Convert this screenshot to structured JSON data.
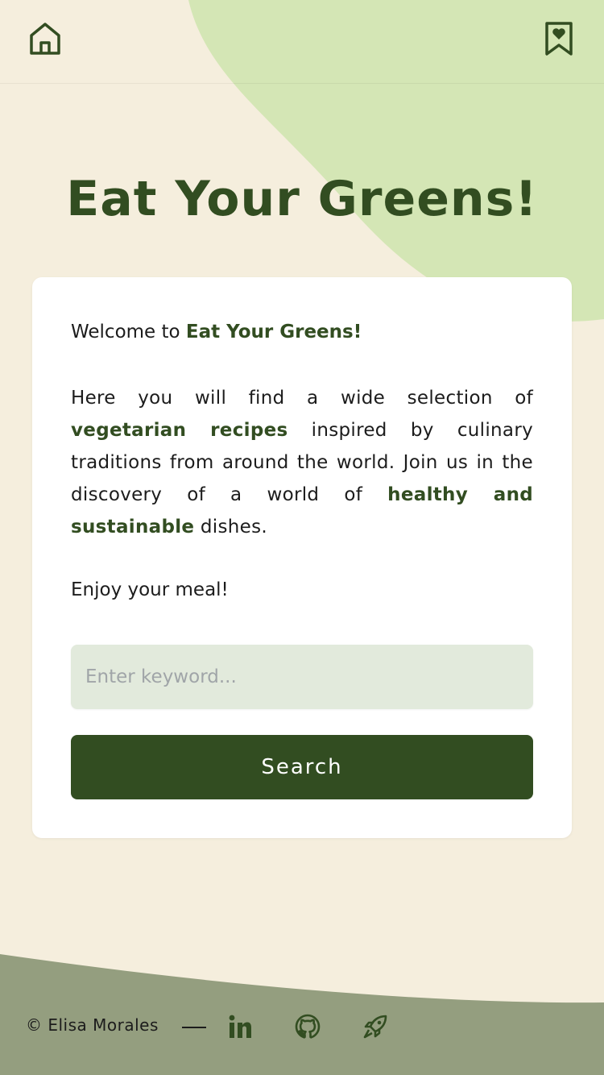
{
  "colors": {
    "background": "#f5eedd",
    "blob": "#d4e6b5",
    "primary_green": "#324d21",
    "input_bg": "#e2eadc",
    "footer_bg": "#949e7f"
  },
  "header": {
    "home_icon": "home-icon",
    "favorites_icon": "bookmark-heart-icon"
  },
  "hero": {
    "title": "Eat Your Greens!"
  },
  "card": {
    "welcome_prefix": "Welcome to ",
    "welcome_brand": "Eat Your Greens!",
    "intro_part1": "Here you will find a wide selection of ",
    "intro_highlight1": "vegetarian recipes",
    "intro_part2": " inspired by culinary traditions from around the world. Join us in the discovery of a world of ",
    "intro_highlight2": "healthy and sustainable",
    "intro_part3": " dishes.",
    "enjoy": "Enjoy your meal!"
  },
  "search": {
    "placeholder": "Enter keyword...",
    "value": "",
    "button_label": "Search"
  },
  "footer": {
    "copyright": "© Elisa Morales",
    "links": [
      {
        "icon": "linkedin-icon"
      },
      {
        "icon": "github-icon"
      },
      {
        "icon": "rocket-icon"
      }
    ]
  }
}
